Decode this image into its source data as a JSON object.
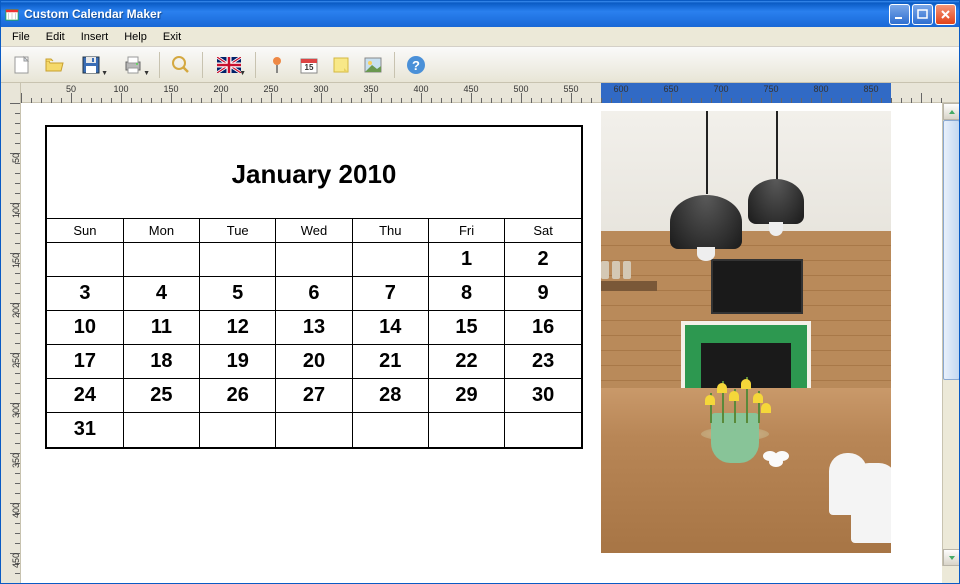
{
  "window": {
    "title": "Custom Calendar Maker"
  },
  "menu": {
    "file": "File",
    "edit": "Edit",
    "insert": "Insert",
    "help": "Help",
    "exit": "Exit"
  },
  "toolbar": {
    "new": "New",
    "open": "Open",
    "save": "Save",
    "print": "Print",
    "zoom": "Zoom",
    "language": "Language",
    "pin": "Pin",
    "calendar_type": "Calendar Type",
    "note": "Note",
    "image": "Insert Image",
    "help": "Help"
  },
  "ruler": {
    "h_labels": [
      "50",
      "100",
      "150",
      "200",
      "250",
      "300",
      "350",
      "400",
      "450",
      "500",
      "550",
      "600",
      "650",
      "700",
      "750",
      "800",
      "850"
    ],
    "v_labels": [
      "50",
      "100",
      "150",
      "200",
      "250",
      "300",
      "350",
      "400",
      "450"
    ],
    "selection_start": 580,
    "selection_end": 870
  },
  "calendar": {
    "title": "January 2010",
    "day_headers": [
      "Sun",
      "Mon",
      "Tue",
      "Wed",
      "Thu",
      "Fri",
      "Sat"
    ],
    "weeks": [
      [
        "",
        "",
        "",
        "",
        "",
        "1",
        "2"
      ],
      [
        "3",
        "4",
        "5",
        "6",
        "7",
        "8",
        "9"
      ],
      [
        "10",
        "11",
        "12",
        "13",
        "14",
        "15",
        "16"
      ],
      [
        "17",
        "18",
        "19",
        "20",
        "21",
        "22",
        "23"
      ],
      [
        "24",
        "25",
        "26",
        "27",
        "28",
        "29",
        "30"
      ],
      [
        "31",
        "",
        "",
        "",
        "",
        "",
        ""
      ]
    ]
  }
}
